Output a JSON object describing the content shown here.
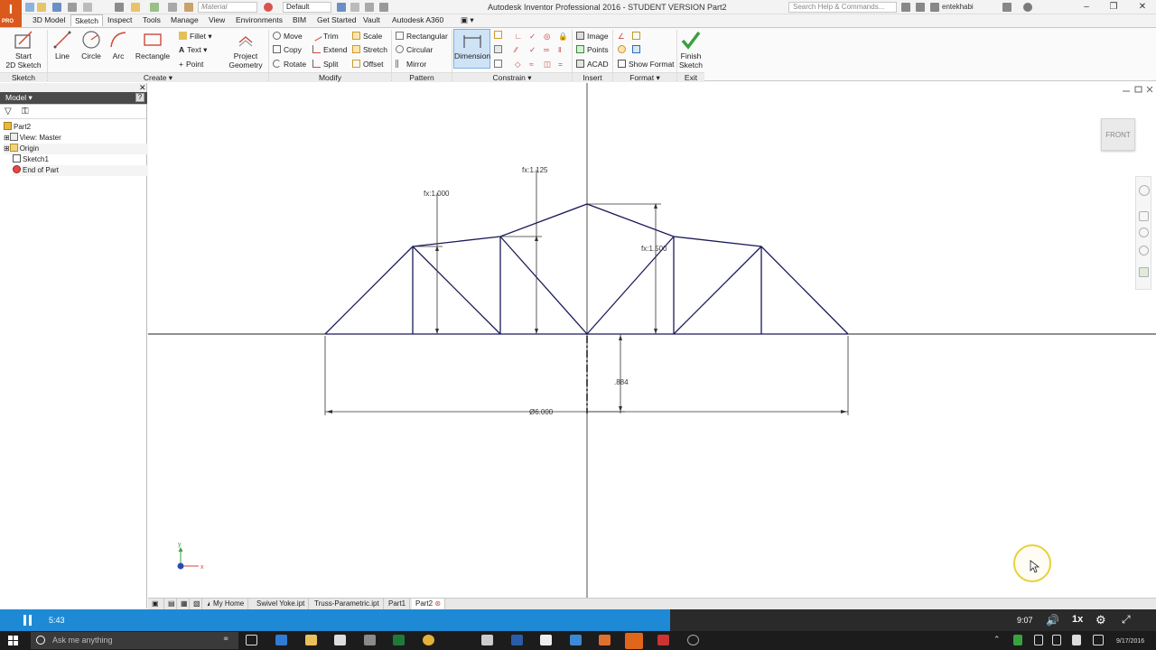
{
  "titlebar": {
    "title": "Autodesk Inventor Professional 2016 - STUDENT VERSION   Part2",
    "material": "Material",
    "appearance": "Default",
    "search_placeholder": "Search Help & Commands...",
    "username": "entekhabi",
    "logo_text": "I",
    "logo_sub": "PRO"
  },
  "ribbon_tabs": [
    "3D Model",
    "Sketch",
    "Inspect",
    "Tools",
    "Manage",
    "View",
    "Environments",
    "BIM",
    "Get Started",
    "Vault",
    "Autodesk A360"
  ],
  "ribbon": {
    "start_sketch": "Start\n2D Sketch",
    "line": "Line",
    "circle": "Circle",
    "arc": "Arc",
    "rectangle": "Rectangle",
    "fillet": "Fillet",
    "text": "Text",
    "point": "Point",
    "project_geometry": "Project\nGeometry",
    "move": "Move",
    "copy": "Copy",
    "rotate": "Rotate",
    "trim": "Trim",
    "extend": "Extend",
    "split": "Split",
    "scale": "Scale",
    "stretch": "Stretch",
    "offset": "Offset",
    "rectangular": "Rectangular",
    "circular": "Circular",
    "mirror": "Mirror",
    "dimension": "Dimension",
    "image": "Image",
    "points": "Points",
    "acad": "ACAD",
    "show_format": "Show Format",
    "finish_sketch": "Finish\nSketch",
    "panels": {
      "sketch": "Sketch",
      "create": "Create",
      "modify": "Modify",
      "pattern": "Pattern",
      "constrain": "Constrain",
      "insert": "Insert",
      "format": "Format",
      "exit": "Exit"
    }
  },
  "browser": {
    "title": "Model",
    "items": [
      "Part2",
      "View: Master",
      "Origin",
      "Sketch1",
      "End of Part"
    ]
  },
  "canvas": {
    "viewcube": "FRONT",
    "dimensions": {
      "left_height": "fx:1.000",
      "mid_height": "fx:1.125",
      "right_height": "fx:1.500",
      "gap": ".884",
      "width": "Ø6.000"
    },
    "axis_x": "x",
    "axis_y": "y"
  },
  "doc_tabs": [
    "My Home",
    "Swivel Yoke.ipt",
    "Truss-Parametric.ipt",
    "Part1",
    "Part2"
  ],
  "video": {
    "current_time": "5:43",
    "total_time": "9:07",
    "speed": "1x",
    "progress": 0.58
  },
  "taskbar": {
    "search_placeholder": "Ask me anything",
    "date": "9/17/2016"
  }
}
